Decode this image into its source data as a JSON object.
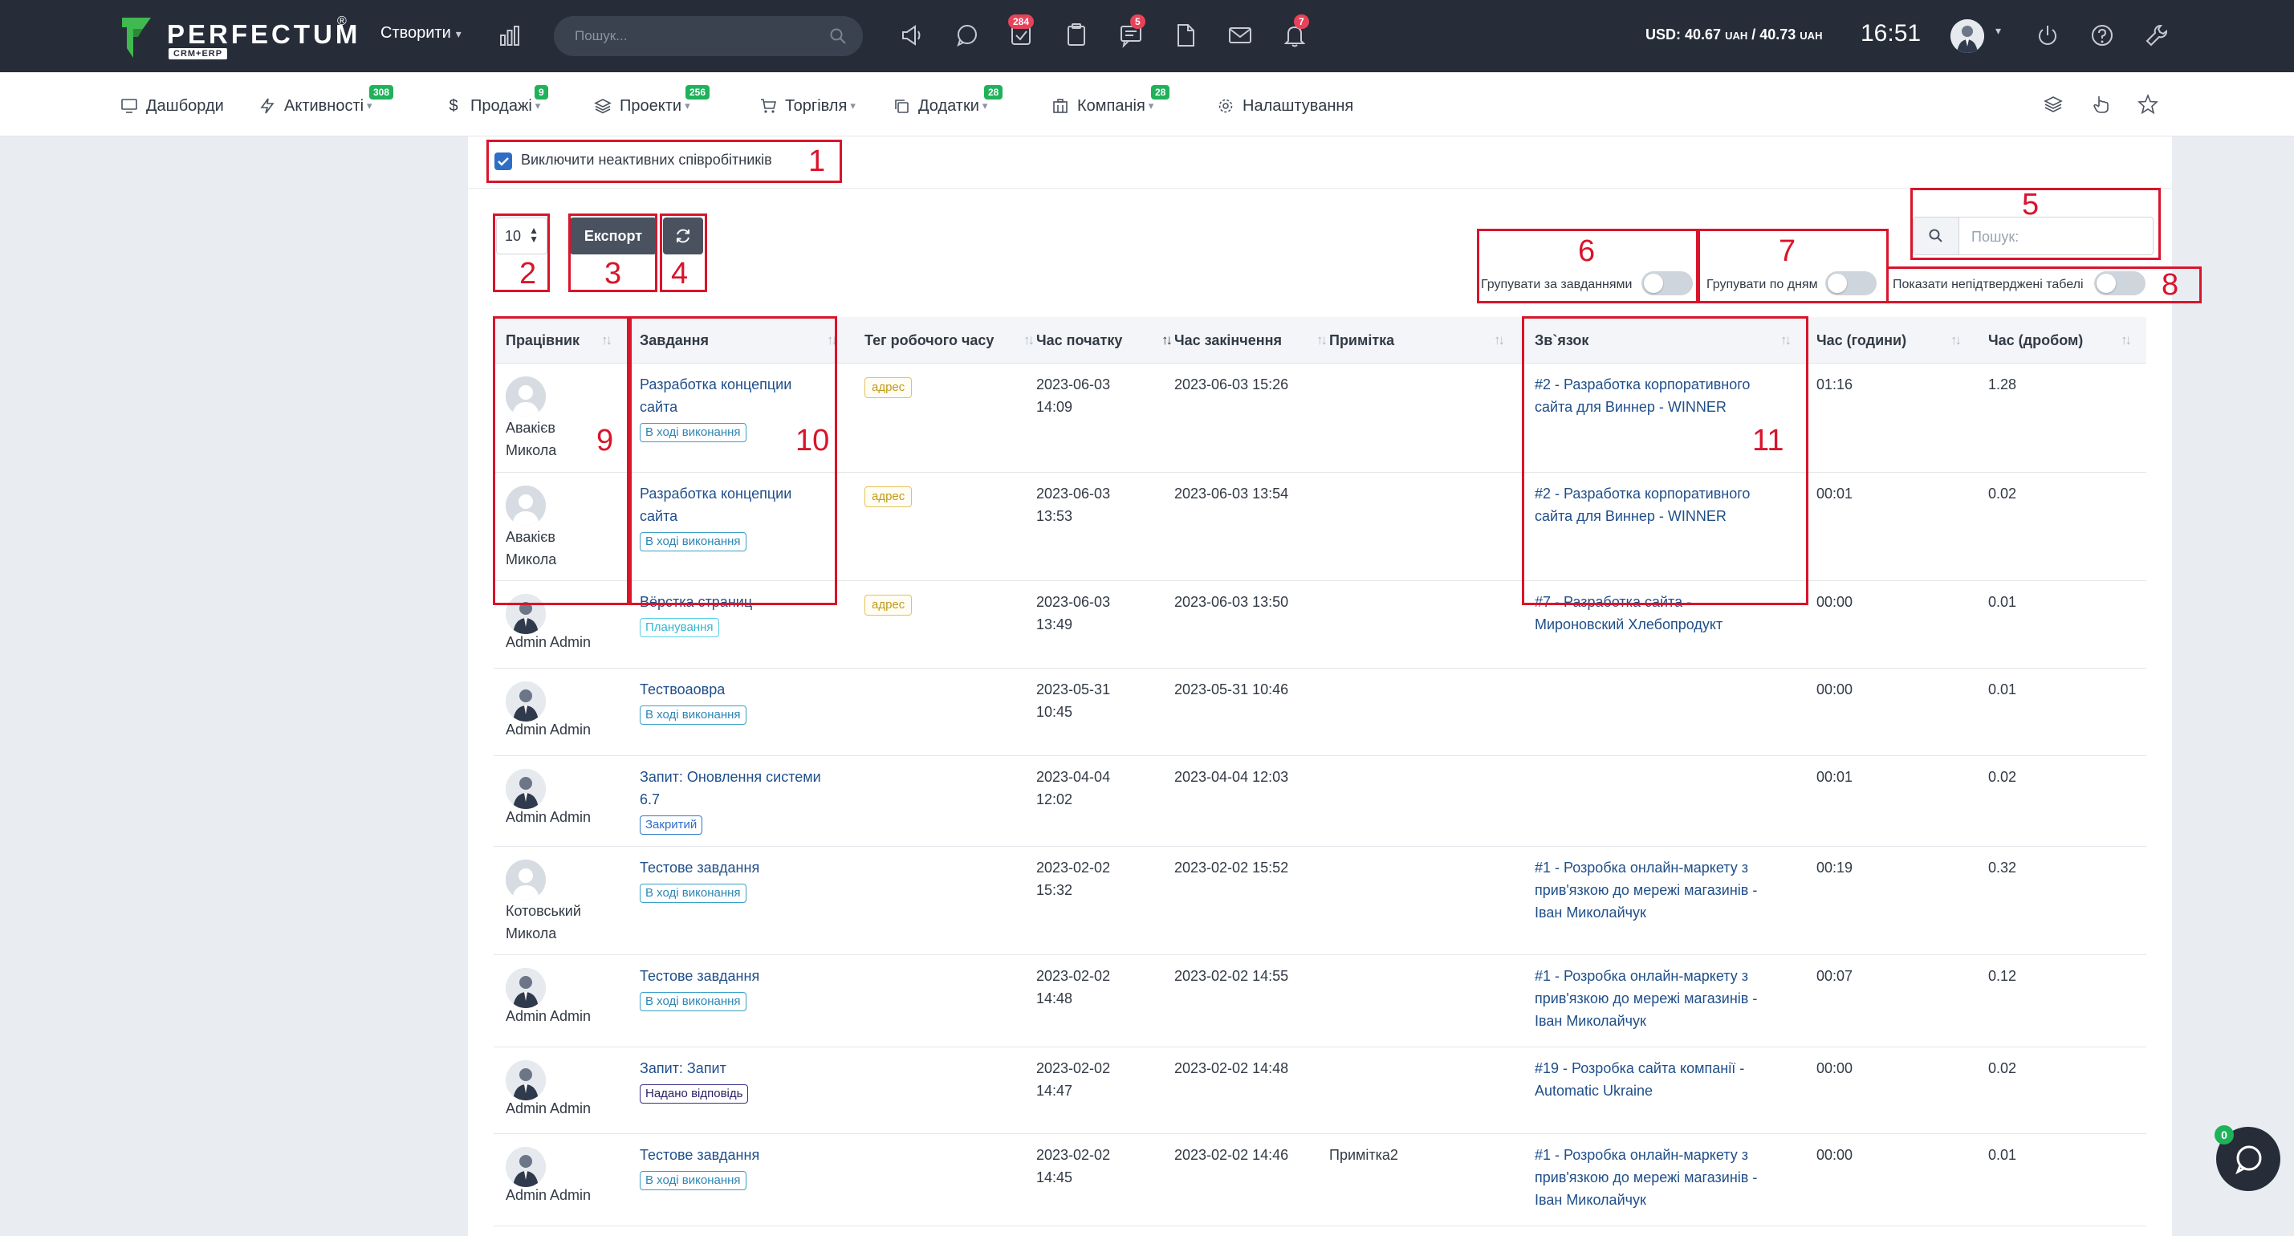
{
  "topbar": {
    "logo": "PERFECTUM",
    "logo_sub": "CRM+ERP",
    "logo_reg": "®",
    "create_label": "Створити",
    "search_placeholder": "Пошук...",
    "badges": {
      "tasks": "284",
      "messages": "5",
      "notifications": "7"
    },
    "currency": "USD: 40.67",
    "currency_unit1": "UAH",
    "currency_sep": " / 40.73",
    "currency_unit2": "UAH",
    "clock": "16:51"
  },
  "menu": {
    "items": [
      {
        "label": "Дашборди",
        "icon": "monitor-icon"
      },
      {
        "label": "Активності",
        "icon": "bolt-icon",
        "badge": "308"
      },
      {
        "label": "Продажі",
        "icon": "dollar-icon",
        "badge": "9"
      },
      {
        "label": "Проекти",
        "icon": "layers-icon",
        "badge": "256"
      },
      {
        "label": "Торгівля",
        "icon": "cart-icon"
      },
      {
        "label": "Додатки",
        "icon": "copy-icon",
        "badge": "28"
      },
      {
        "label": "Компанія",
        "icon": "building-icon",
        "badge": "28"
      },
      {
        "label": "Налаштування",
        "icon": "gear-icon"
      }
    ]
  },
  "filters": {
    "exclude_inactive": "Виключити неактивних співробітників",
    "page_length": "10",
    "export_label": "Експорт",
    "search_placeholder": "Пошук:",
    "group_by_tasks": "Групувати за завданнями",
    "group_by_days": "Групувати по дням",
    "show_unconfirmed": "Показати непідтверджені табелі"
  },
  "table": {
    "columns": [
      "Працівник",
      "Завдання",
      "Тег робочого часу",
      "Час початку",
      "Час закінчення",
      "Примітка",
      "Зв`язок",
      "Час (години)",
      "Час (дробом)"
    ],
    "rows": [
      {
        "emp1": "Авакієв",
        "emp2": "Микола",
        "task1": "Разработка концепции",
        "task2": "сайта",
        "status": "В ході виконання",
        "tag": "адрес",
        "start1": "2023-06-03",
        "start2": "14:09",
        "end": "2023-06-03 15:26",
        "note": "",
        "rel1": "#2 - Разработка корпоративного",
        "rel2": "сайта для Виннер - WINNER",
        "rel3": "",
        "hours": "01:16",
        "frac": "1.28"
      },
      {
        "emp1": "Авакієв",
        "emp2": "Микола",
        "task1": "Разработка концепции",
        "task2": "сайта",
        "status": "В ході виконання",
        "tag": "адрес",
        "start1": "2023-06-03",
        "start2": "13:53",
        "end": "2023-06-03 13:54",
        "note": "",
        "rel1": "#2 - Разработка корпоративного",
        "rel2": "сайта для Виннер - WINNER",
        "rel3": "",
        "hours": "00:01",
        "frac": "0.02"
      },
      {
        "emp1": "Admin Admin",
        "emp2": "",
        "task1": "Вёрстка страниц",
        "task2": "",
        "status": "Планування",
        "tag": "адрес",
        "start1": "2023-06-03",
        "start2": "13:49",
        "end": "2023-06-03 13:50",
        "note": "",
        "rel1": "#7 - Разработка сайта -",
        "rel2": "Мироновский Хлебопродукт",
        "rel3": "",
        "hours": "00:00",
        "frac": "0.01"
      },
      {
        "emp1": "Admin Admin",
        "emp2": "",
        "task1": "Тествоаовра",
        "task2": "",
        "status": "В ході виконання",
        "tag": "",
        "start1": "2023-05-31",
        "start2": "10:45",
        "end": "2023-05-31 10:46",
        "note": "",
        "rel1": "",
        "rel2": "",
        "rel3": "",
        "hours": "00:00",
        "frac": "0.01"
      },
      {
        "emp1": "Admin Admin",
        "emp2": "",
        "task1": "Запит: Оновлення системи",
        "task2": "6.7",
        "status": "Закритий",
        "tag": "",
        "start1": "2023-04-04",
        "start2": "12:02",
        "end": "2023-04-04 12:03",
        "note": "",
        "rel1": "",
        "rel2": "",
        "rel3": "",
        "hours": "00:01",
        "frac": "0.02"
      },
      {
        "emp1": "Котовський",
        "emp2": "Микола",
        "task1": "Тестове завдання",
        "task2": "",
        "status": "В ході виконання",
        "tag": "",
        "start1": "2023-02-02",
        "start2": "15:32",
        "end": "2023-02-02 15:52",
        "note": "",
        "rel1": "#1 - Розробка онлайн-маркету з",
        "rel2": "прив'язкою до мережі магазинів -",
        "rel3": "Іван Миколайчук",
        "hours": "00:19",
        "frac": "0.32"
      },
      {
        "emp1": "Admin Admin",
        "emp2": "",
        "task1": "Тестове завдання",
        "task2": "",
        "status": "В ході виконання",
        "tag": "",
        "start1": "2023-02-02",
        "start2": "14:48",
        "end": "2023-02-02 14:55",
        "note": "",
        "rel1": "#1 - Розробка онлайн-маркету з",
        "rel2": "прив'язкою до мережі магазинів -",
        "rel3": "Іван Миколайчук",
        "hours": "00:07",
        "frac": "0.12"
      },
      {
        "emp1": "Admin Admin",
        "emp2": "",
        "task1": "Запит: Запит",
        "task2": "",
        "status": "Надано відповідь",
        "tag": "",
        "start1": "2023-02-02",
        "start2": "14:47",
        "end": "2023-02-02 14:48",
        "note": "",
        "rel1": "#19 - Розробка сайта компанії -",
        "rel2": "Automatic Ukraine",
        "rel3": "",
        "hours": "00:00",
        "frac": "0.02"
      },
      {
        "emp1": "Admin Admin",
        "emp2": "",
        "task1": "Тестове завдання",
        "task2": "",
        "status": "В ході виконання",
        "tag": "",
        "start1": "2023-02-02",
        "start2": "14:45",
        "end": "2023-02-02 14:46",
        "note": "Примітка2",
        "rel1": "#1 - Розробка онлайн-маркету з",
        "rel2": "прив'язкою до мережі магазинів -",
        "rel3": "Іван Миколайчук",
        "hours": "00:00",
        "frac": "0.01"
      }
    ]
  },
  "annotations": [
    "1",
    "2",
    "3",
    "4",
    "5",
    "6",
    "7",
    "8",
    "9",
    "10",
    "11"
  ],
  "chat": {
    "badge": "0"
  },
  "colors": {
    "topbar": "#262d39",
    "accent_red": "#d9142b",
    "badge_green": "#1fb25a",
    "link": "#1f4f8a"
  }
}
